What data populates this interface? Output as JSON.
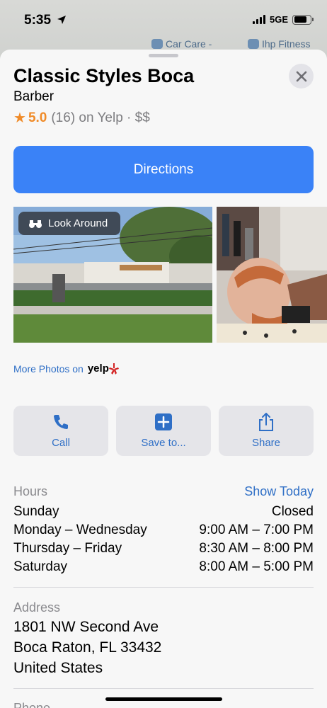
{
  "status": {
    "time": "5:35",
    "network": "5GE"
  },
  "map": {
    "labels": [
      "Car Care -",
      "Ihp Fitness"
    ]
  },
  "place": {
    "name": "Classic Styles Boca",
    "category": "Barber",
    "rating": "5.0",
    "rating_rest": "(16) on Yelp · $$"
  },
  "buttons": {
    "directions": "Directions",
    "look_around": "Look Around",
    "call": "Call",
    "save": "Save to...",
    "share": "Share"
  },
  "photos": {
    "more": "More Photos on",
    "provider": "yelp"
  },
  "hours": {
    "label": "Hours",
    "show_today": "Show Today",
    "rows": [
      {
        "day": "Sunday",
        "time": "Closed"
      },
      {
        "day": "Monday – Wednesday",
        "time": "9:00 AM – 7:00 PM"
      },
      {
        "day": "Thursday – Friday",
        "time": "8:30 AM – 8:00 PM"
      },
      {
        "day": "Saturday",
        "time": "8:00 AM – 5:00 PM"
      }
    ]
  },
  "address": {
    "label": "Address",
    "lines": [
      "1801 NW Second Ave",
      "Boca Raton, FL  33432",
      "United States"
    ]
  },
  "phone": {
    "label": "Phone"
  },
  "colors": {
    "accent": "#3a82f7",
    "link": "#2f6fc6",
    "star": "#f08b28"
  }
}
